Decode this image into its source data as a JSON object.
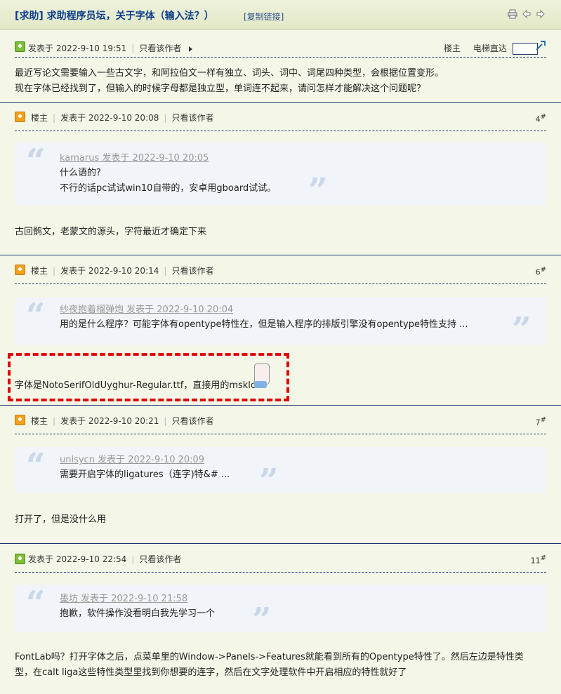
{
  "header": {
    "title": "[求助] 求助程序员坛，关于字体（输入法？）",
    "copy_link": "[复制链接]"
  },
  "op": {
    "posted": "发表于 2022-9-10 19:51",
    "only_author": "只看该作者",
    "louzhu": "楼主",
    "ladder": "电梯直达",
    "line1": "最近写论文需要输入一些古文字，和阿拉伯文一样有独立、词头、词中、词尾四种类型，会根据位置变形。",
    "line2": "现在字体已经找到了，但输入的时候字母都是独立型，单词连不起来，请问怎样才能解决这个问题呢？"
  },
  "posts": [
    {
      "role": "楼主",
      "posted": "发表于 2022-9-10 20:08",
      "only_author": "只看该作者",
      "floor": "4",
      "quote_head": "kamarus 发表于 2022-9-10 20:05",
      "quote_l1": "什么语的?",
      "quote_l2": "不行的话pc试试win10自带的，安卓用gboard试试。",
      "reply": "古回鹘文，老蒙文的源头，字符最近才确定下来"
    },
    {
      "role": "楼主",
      "posted": "发表于 2022-9-10 20:14",
      "only_author": "只看该作者",
      "floor": "6",
      "quote_head": "纱夜抱着榴弹炮 发表于 2022-9-10 20:04",
      "quote_l1": "用的是什么程序？可能字体有opentype特性在，但是输入程序的排版引擎没有opentype特性支持 ...",
      "reply": "字体是NotoSerifOldUyghur-Regular.ttf，直接用的msklc"
    },
    {
      "role": "楼主",
      "posted": "发表于 2022-9-10 20:21",
      "only_author": "只看该作者",
      "floor": "7",
      "quote_head": "unlsycn 发表于 2022-9-10 20:09",
      "quote_l1": "需要开启字体的ligatures（连字)特&# ...",
      "reply": "打开了，但是没什么用"
    },
    {
      "posted": "发表于 2022-9-10 22:54",
      "only_author": "只看该作者",
      "floor": "11",
      "quote_head": "墨坊 发表于 2022-9-10 21:58",
      "quote_l1": "抱歉，软件操作没看明白我先学习一个",
      "reply1": "FontLab吗？打开字体之后，点菜单里的Window->Panels->Features就能看到所有的Opentype特性了。然后左边是特性类",
      "reply2": "型，在calt liga这些特性类型里找到你想要的连字，然后在文字处理软件中开启相应的特性就好了"
    }
  ],
  "floor_mark": "#",
  "quote_open": "“",
  "quote_close": "”",
  "icons": [
    "print-icon",
    "prev-thread-icon",
    "next-thread-icon",
    "jump-icon",
    "triangle-right-icon"
  ]
}
